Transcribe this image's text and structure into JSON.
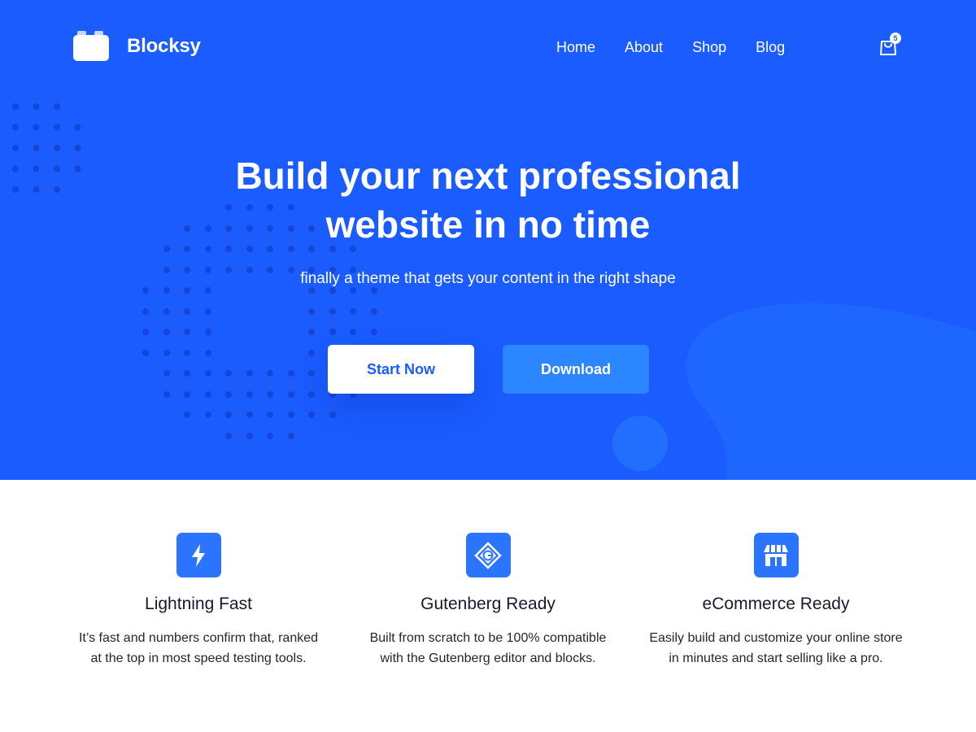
{
  "header": {
    "brand": "Blocksy",
    "nav": [
      "Home",
      "About",
      "Shop",
      "Blog"
    ],
    "cart_count": "5"
  },
  "hero": {
    "title_line1": "Build your next professional",
    "title_line2": "website in no time",
    "subtitle": "finally a theme that gets your content in the right shape",
    "primary_button": "Start Now",
    "secondary_button": "Download"
  },
  "features": [
    {
      "icon": "lightning-icon",
      "title": "Lightning Fast",
      "line1": "It’s fast and numbers confirm that, ranked",
      "line2": "at the top in most speed testing tools."
    },
    {
      "icon": "gutenberg-icon",
      "title": "Gutenberg Ready",
      "line1": "Built from scratch to be 100% compatible",
      "line2": "with the Gutenberg editor and blocks."
    },
    {
      "icon": "store-icon",
      "title": "eCommerce Ready",
      "line1": "Easily build and customize your online store",
      "line2": "in minutes and start selling like a pro."
    }
  ],
  "colors": {
    "hero_bg": "#1a5cff",
    "download_button": "#2c86ff",
    "feature_icon_bg": "#2b74ff",
    "dot_color": "#1447d8"
  }
}
